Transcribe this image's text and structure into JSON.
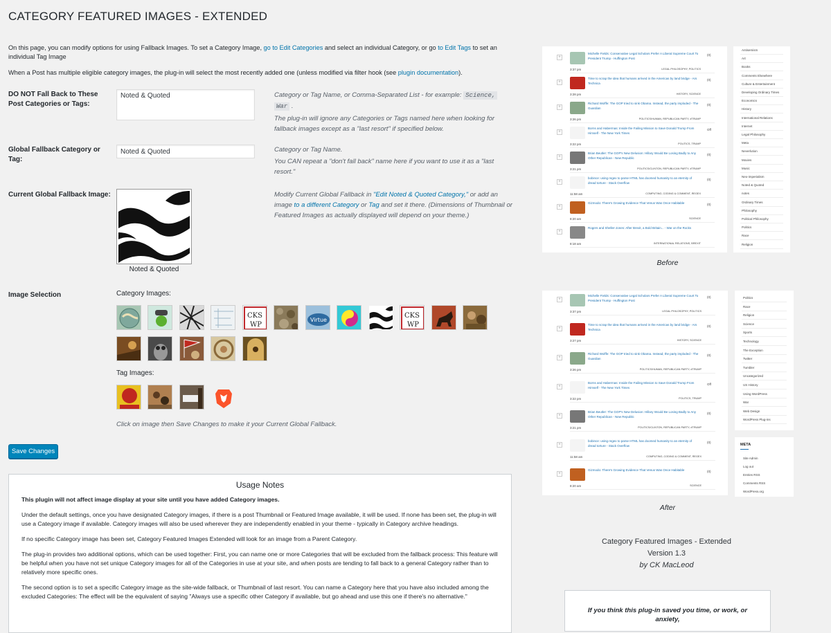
{
  "page": {
    "title": "CATEGORY FEATURED IMAGES - EXTENDED",
    "intro1_a": "On this page, you can modify options for using Fallback Images. To set a Category Image, ",
    "intro1_link1": "go to Edit Categories",
    "intro1_b": " and select an individual Category, or go ",
    "intro1_link2": "to Edit Tags",
    "intro1_c": " to set an individual Tag Image",
    "intro2_a": "When a Post has multiple eligible category images, the plug-in will select the most recently added one (unless modified via filter hook (see ",
    "intro2_link": "plugin documentation",
    "intro2_b": ")."
  },
  "form": {
    "exclude": {
      "label": "DO NOT Fall Back to These Post Categories or Tags:",
      "value": "Noted & Quoted",
      "desc1_a": "Category or Tag Name, or Comma-Separated List - for example: ",
      "desc1_code1": "Science,",
      "desc1_code2": "War",
      "desc1_b": " .",
      "desc2": "The plug-in will ignore any Categories or Tags named here when looking for fallback images except as a \"last resort\" if specified below."
    },
    "global": {
      "label": "Global Fallback Category or Tag:",
      "value": "Noted & Quoted",
      "desc1": "Category or Tag Name.",
      "desc2": "You CAN repeat a \"don't fall back\" name here if you want to use it as a \"last resort.\""
    },
    "current": {
      "label": "Current Global Fallback Image:",
      "caption": "Noted & Quoted",
      "desc_a": "Modify Current Global Fallback in ",
      "desc_link1": "\"Edit Noted & Quoted Category,\"",
      "desc_b": " or add an image ",
      "desc_link2": "to a different Category",
      "desc_c": " or ",
      "desc_link3": "Tag",
      "desc_d": " and set it there. (Dimensions of Thumbnail or Featured Images as actually displayed will depend on your theme.)"
    },
    "selection": {
      "label": "Image Selection",
      "category_heading": "Category Images:",
      "tag_heading": "Tag Images:",
      "hint": "Click on image then Save Changes to make it your Current Global Fallback."
    },
    "save_label": "Save Changes"
  },
  "category_images": [
    {
      "icon": "globe-map-thumb",
      "color": "#a7c6b3"
    },
    {
      "icon": "green-figure-thumb",
      "color": "#cfe8de"
    },
    {
      "icon": "sketch-thumb",
      "color": "#6b6b6b"
    },
    {
      "icon": "blueprint-thumb",
      "color": "#dfe7ea"
    },
    {
      "icon": "ckwp-logo-thumb",
      "color": "#ffffff"
    },
    {
      "icon": "rocks-thumb",
      "color": "#8a7a5a"
    },
    {
      "icon": "virtue-sign-thumb",
      "color": "#4f86b0"
    },
    {
      "icon": "yin-yang-thumb",
      "color": "#33c9d6"
    },
    {
      "icon": "wave-logo-thumb",
      "color": "#ffffff"
    },
    {
      "icon": "ckwp-logo-thumb",
      "color": "#ffffff"
    },
    {
      "icon": "horse-rider-thumb",
      "color": "#5c3a2a"
    },
    {
      "icon": "painting-thumb",
      "color": "#8a6a3c"
    },
    {
      "icon": "battle-painting-thumb",
      "color": "#7a4d22"
    },
    {
      "icon": "owl-thumb",
      "color": "#555555"
    },
    {
      "icon": "flag-crowd-thumb",
      "color": "#b0472e"
    },
    {
      "icon": "mosaic-thumb",
      "color": "#b89a6e"
    },
    {
      "icon": "arch-figure-thumb",
      "color": "#9a7a3a"
    }
  ],
  "tag_images": [
    {
      "icon": "fear-poster-thumb",
      "color": "#c0281f"
    },
    {
      "icon": "colonial-scene-thumb",
      "color": "#8a5a3a"
    },
    {
      "icon": "street-sign-thumb",
      "color": "#6a5a4a"
    },
    {
      "icon": "brave-lion-icon",
      "color": "#fb542b"
    }
  ],
  "usage": {
    "title": "Usage Notes",
    "p1": "This plugin will not affect image display at your site until you have added Category images.",
    "p2": "Under the default settings, once you have designated Category images, if there is a post Thumbnail or Featured Image available, it will be used. If none has been set, the plug-in will use a Category image if available. Category images will also be used wherever they are independently enabled in your theme - typically in Category archive headings.",
    "p3": "If no specific Category image has been set, Category Featured Images Extended will look for an image from a Parent Category.",
    "p4": "The plug-in provides two additional options, which can be used together: First, you can name one or more Categories that will be excluded from the fallback process: This feature will be helpful when you have not set unique Category images for all of the Categories in use at your site, and when posts are tending to fall back to a general Category rather than to relatively more specific ones.",
    "p5": "The second option is to set a specific Category image as the site-wide fallback, or Thumbnail of last resort. You can name a Category here that you have also included among the excluded Categories: The effect will be the equivalent of saying \"Always use a specific other Category if available, but go ahead and use this one if there's no alternative.\""
  },
  "before_shot": {
    "caption": "Before",
    "posts": [
      {
        "title": "Michelle Fields: Conservative Legal Scholars Prefer A Liberal Supreme Court To President Trump - Huffington Post",
        "time": "3:37 pm",
        "cat": "LEGAL PHILOSOPHY, POLITICS",
        "count": "(0)"
      },
      {
        "title": "Time to scrap the idea that humans arrived in the Americas by land bridge - Ars Technica",
        "time": "3:28 pm",
        "cat": "HISTORY, SCIENCE",
        "count": "(0)"
      },
      {
        "title": "Richard Wolffe: The GOP tried to sink Obama. Instead, the party imploded - The Guardian",
        "time": "3:26 pm",
        "cat": "POLITICS/HUMAN, REPUBLICAN PARTY, #TRUMP",
        "count": "(0)"
      },
      {
        "title": "Borns and Habermas: Inside the Failing Mission to Save Donald Trump From Himself - The New York Times",
        "time": "3:22 pm",
        "cat": "POLITICS, TRUMP",
        "count": "Off"
      },
      {
        "title": "Brian Beutler: The GOP's New Delusion: Hillary Would Be Losing Badly to Any Other Republican - New Republic",
        "time": "3:21 pm",
        "cat": "POLITICS/CLINTON, REPUBLICAN PARTY, #TRUMP",
        "count": "(0)"
      },
      {
        "title": "bobince: using regex to parse HTML has doomed humanity to an eternity of dread torture - Stack Overflow",
        "time": "11:58 am",
        "cat": "COMPUTING, CODING & COMMENT, REGEX",
        "count": "(0)"
      },
      {
        "title": "Gizmodo: There's Growing Evidence That Venus Was Once Habitable",
        "time": "8:20 am",
        "cat": "SCIENCE",
        "count": "(0)"
      },
      {
        "title": "Rogers and Sheller-Jones: After Brexit, a Bold Britain... - War on the Rocks",
        "time": "8:18 am",
        "cat": "INTERNATIONAL RELATIONS, BREXIT",
        "count": ""
      }
    ],
    "categories": [
      "Antisemism",
      "Art",
      "Books",
      "Comments Elsewhere",
      "Culture & Entertainment",
      "Developing Ordinary Times",
      "Economics",
      "History",
      "International Relations",
      "Internet",
      "Legal Philosophy",
      "Meta",
      "Neverlution",
      "Movies",
      "Music",
      "Neo-imperialism",
      "Noted & Quoted",
      "notes",
      "Ordinary Times",
      "Philosophy",
      "Political Philosophy",
      "Politics",
      "Race",
      "Religion"
    ]
  },
  "after_shot": {
    "caption": "After",
    "posts": [
      {
        "title": "Michelle Fields: Conservative Legal Scholars Prefer A Liberal Supreme Court To President Trump - Huffington Post",
        "time": "3:37 pm",
        "cat": "LEGAL PHILOSOPHY, POLITICS",
        "count": "(0)"
      },
      {
        "title": "Time to scrap the idea that humans arrived in the Americas by land bridge - Ars Technica",
        "time": "3:27 pm",
        "cat": "HISTORY, SCIENCE",
        "count": "(0)"
      },
      {
        "title": "Richard Wolffe: The GOP tried to sink Obama. Instead, the party imploded - The Guardian",
        "time": "3:26 pm",
        "cat": "POLITICS/HUMAN, REPUBLICAN PARTY, #TRUMP",
        "count": "(0)"
      },
      {
        "title": "Borns and Habermas: Inside the Failing Mission to Save Donald Trump From Himself - The New York Times",
        "time": "3:22 pm",
        "cat": "POLITICS, TRUMP",
        "count": "Off"
      },
      {
        "title": "Brian Beutler: The GOP's New Delusion: Hillary Would Be Losing Badly to Any Other Republican - New Republic",
        "time": "3:21 pm",
        "cat": "POLITICS/CLINTON, REPUBLICAN PARTY, #TRUMP",
        "count": "(0)"
      },
      {
        "title": "bobince: using regex to parse HTML has doomed humanity to an eternity of dread torture - Stack Overflow",
        "time": "11:58 am",
        "cat": "COMPUTING, CODING & COMMENT, REGEX",
        "count": "(0)"
      },
      {
        "title": "Gizmodo: There's Growing Evidence That Venus Was Once Habitable",
        "time": "8:20 am",
        "cat": "SCIENCE",
        "count": "(0)"
      }
    ],
    "categories": [
      "Politics",
      "Race",
      "Religion",
      "Science",
      "Sports",
      "Technology",
      "The Exception",
      "Twitter",
      "Tumbler",
      "Uncategorized",
      "US History",
      "Using WordPress",
      "War",
      "Web Design",
      "WordPress Plug-ins"
    ],
    "meta_heading": "META",
    "meta_links": [
      "Site Admin",
      "Log out",
      "Entries RSS",
      "Comments RSS",
      "WordPress.org"
    ]
  },
  "credit": {
    "line1": "Category Featured Images - Extended",
    "line2": "Version 1.3",
    "line3": "by CK MacLeod"
  },
  "donate": {
    "text": "If you think this plug-in saved you time, or work, or anxiety,"
  }
}
